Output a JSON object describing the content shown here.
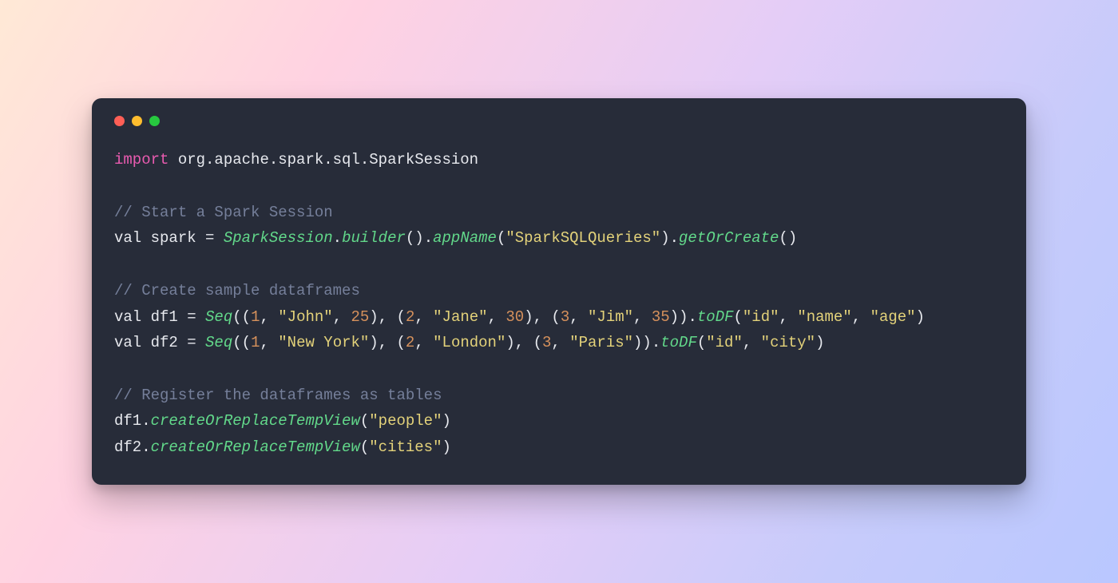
{
  "colors": {
    "window_bg": "#272c39",
    "traffic": {
      "red": "#ff5f56",
      "yellow": "#ffbd2e",
      "green": "#27c93f"
    },
    "token": {
      "keyword": "#e95bb0",
      "comment": "#757f9a",
      "function": "#62d88a",
      "string": "#e3d27a",
      "number": "#d6915c",
      "plain": "#e7e9ee"
    }
  },
  "language": "scala",
  "code_lines": [
    [
      {
        "t": "kw",
        "v": "import"
      },
      {
        "t": "pl",
        "v": " org.apache.spark.sql.SparkSession"
      }
    ],
    [],
    [
      {
        "t": "cmt",
        "v": "// Start a Spark Session"
      }
    ],
    [
      {
        "t": "pl",
        "v": "val spark = "
      },
      {
        "t": "fn",
        "v": "SparkSession"
      },
      {
        "t": "pl",
        "v": "."
      },
      {
        "t": "fn",
        "v": "builder"
      },
      {
        "t": "pl",
        "v": "()."
      },
      {
        "t": "fn",
        "v": "appName"
      },
      {
        "t": "pl",
        "v": "("
      },
      {
        "t": "str",
        "v": "\"SparkSQLQueries\""
      },
      {
        "t": "pl",
        "v": ")."
      },
      {
        "t": "fn",
        "v": "getOrCreate"
      },
      {
        "t": "pl",
        "v": "()"
      }
    ],
    [],
    [
      {
        "t": "cmt",
        "v": "// Create sample dataframes"
      }
    ],
    [
      {
        "t": "pl",
        "v": "val df1 = "
      },
      {
        "t": "fn",
        "v": "Seq"
      },
      {
        "t": "pl",
        "v": "(("
      },
      {
        "t": "num",
        "v": "1"
      },
      {
        "t": "pl",
        "v": ", "
      },
      {
        "t": "str",
        "v": "\"John\""
      },
      {
        "t": "pl",
        "v": ", "
      },
      {
        "t": "num",
        "v": "25"
      },
      {
        "t": "pl",
        "v": "), ("
      },
      {
        "t": "num",
        "v": "2"
      },
      {
        "t": "pl",
        "v": ", "
      },
      {
        "t": "str",
        "v": "\"Jane\""
      },
      {
        "t": "pl",
        "v": ", "
      },
      {
        "t": "num",
        "v": "30"
      },
      {
        "t": "pl",
        "v": "), ("
      },
      {
        "t": "num",
        "v": "3"
      },
      {
        "t": "pl",
        "v": ", "
      },
      {
        "t": "str",
        "v": "\"Jim\""
      },
      {
        "t": "pl",
        "v": ", "
      },
      {
        "t": "num",
        "v": "35"
      },
      {
        "t": "pl",
        "v": "))."
      },
      {
        "t": "fn",
        "v": "toDF"
      },
      {
        "t": "pl",
        "v": "("
      },
      {
        "t": "str",
        "v": "\"id\""
      },
      {
        "t": "pl",
        "v": ", "
      },
      {
        "t": "str",
        "v": "\"name\""
      },
      {
        "t": "pl",
        "v": ", "
      },
      {
        "t": "str",
        "v": "\"age\""
      },
      {
        "t": "pl",
        "v": ")"
      }
    ],
    [
      {
        "t": "pl",
        "v": "val df2 = "
      },
      {
        "t": "fn",
        "v": "Seq"
      },
      {
        "t": "pl",
        "v": "(("
      },
      {
        "t": "num",
        "v": "1"
      },
      {
        "t": "pl",
        "v": ", "
      },
      {
        "t": "str",
        "v": "\"New York\""
      },
      {
        "t": "pl",
        "v": "), ("
      },
      {
        "t": "num",
        "v": "2"
      },
      {
        "t": "pl",
        "v": ", "
      },
      {
        "t": "str",
        "v": "\"London\""
      },
      {
        "t": "pl",
        "v": "), ("
      },
      {
        "t": "num",
        "v": "3"
      },
      {
        "t": "pl",
        "v": ", "
      },
      {
        "t": "str",
        "v": "\"Paris\""
      },
      {
        "t": "pl",
        "v": "))."
      },
      {
        "t": "fn",
        "v": "toDF"
      },
      {
        "t": "pl",
        "v": "("
      },
      {
        "t": "str",
        "v": "\"id\""
      },
      {
        "t": "pl",
        "v": ", "
      },
      {
        "t": "str",
        "v": "\"city\""
      },
      {
        "t": "pl",
        "v": ")"
      }
    ],
    [],
    [
      {
        "t": "cmt",
        "v": "// Register the dataframes as tables"
      }
    ],
    [
      {
        "t": "pl",
        "v": "df1."
      },
      {
        "t": "fn",
        "v": "createOrReplaceTempView"
      },
      {
        "t": "pl",
        "v": "("
      },
      {
        "t": "str",
        "v": "\"people\""
      },
      {
        "t": "pl",
        "v": ")"
      }
    ],
    [
      {
        "t": "pl",
        "v": "df2."
      },
      {
        "t": "fn",
        "v": "createOrReplaceTempView"
      },
      {
        "t": "pl",
        "v": "("
      },
      {
        "t": "str",
        "v": "\"cities\""
      },
      {
        "t": "pl",
        "v": ")"
      }
    ]
  ]
}
